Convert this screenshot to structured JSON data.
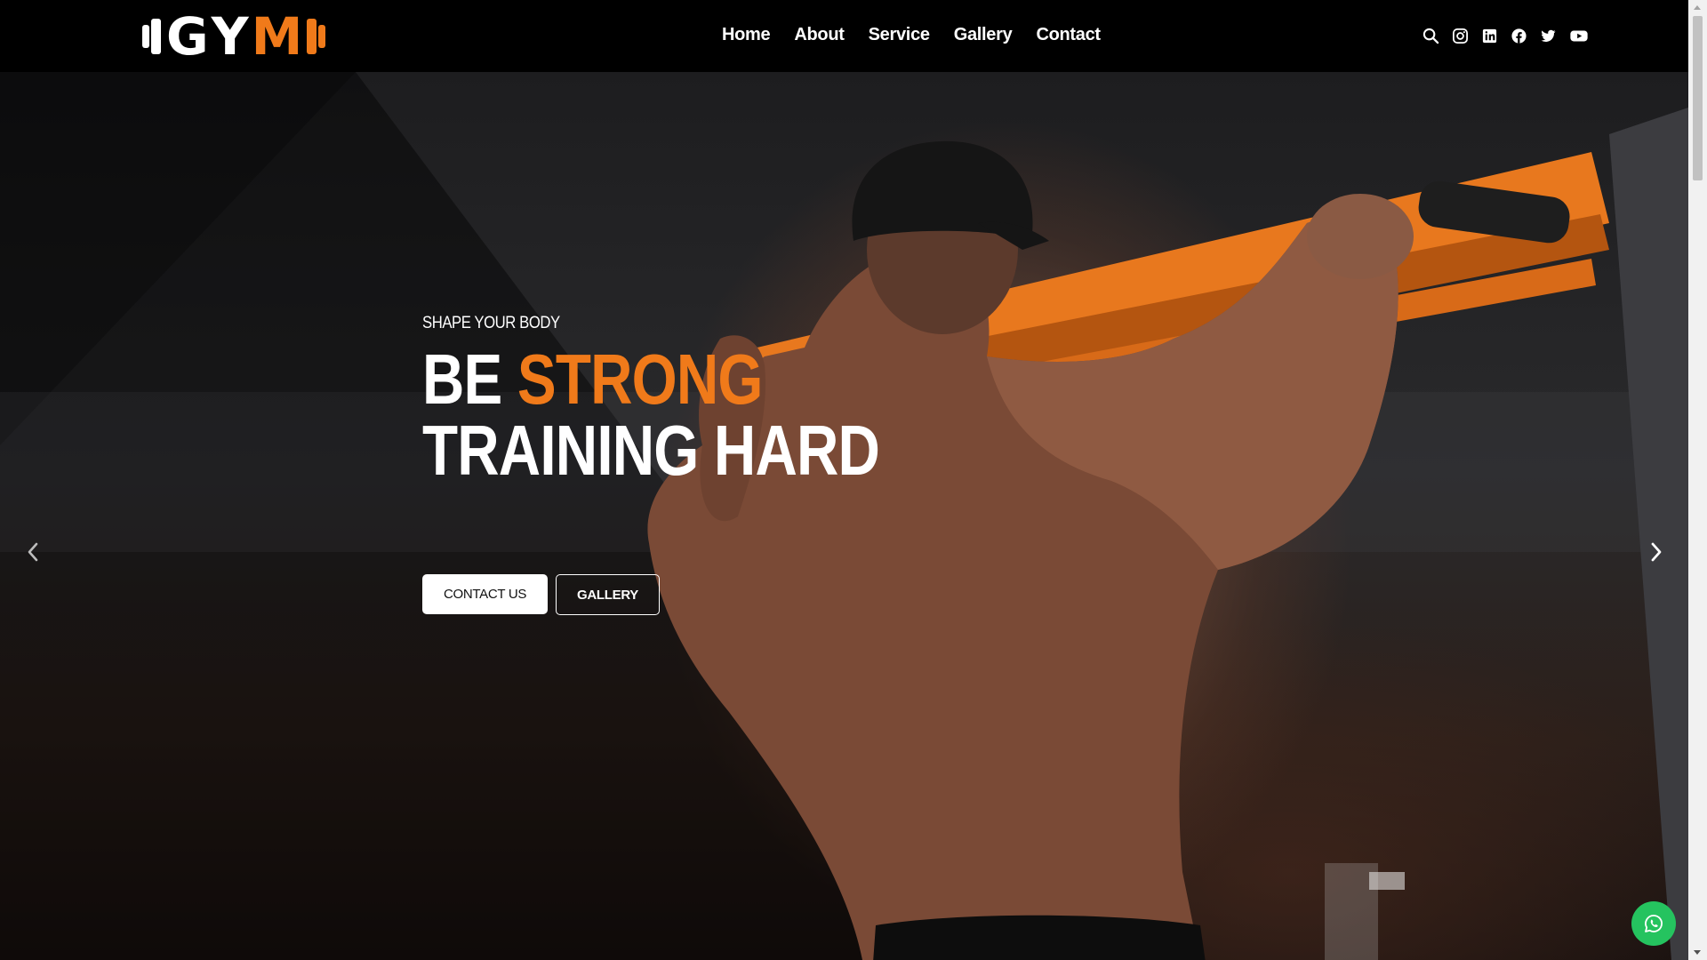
{
  "brand": {
    "letters": [
      "G",
      "Y",
      "M"
    ],
    "accent_color": "#f07a1a"
  },
  "nav": {
    "items": [
      "Home",
      "About",
      "Service",
      "Gallery",
      "Contact"
    ]
  },
  "header_icons": [
    "search-icon",
    "instagram-icon",
    "linkedin-icon",
    "facebook-icon",
    "twitter-icon",
    "youtube-icon"
  ],
  "hero": {
    "subtitle": "SHAPE YOUR BODY",
    "headline_part1": "BE ",
    "headline_accent": "STRONG",
    "headline_line2": "TRAINING HARD",
    "buttons": {
      "contact": "CONTACT US",
      "gallery": "GALLERY"
    }
  },
  "carousel": {
    "prev_icon": "chevron-left-icon",
    "next_icon": "chevron-right-icon"
  },
  "floating": {
    "icon": "whatsapp-icon",
    "color": "#25c35f"
  }
}
